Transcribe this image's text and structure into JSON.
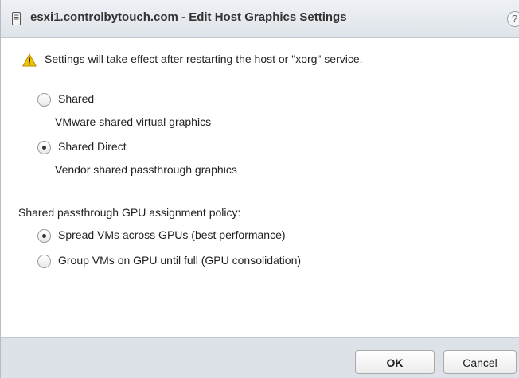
{
  "dialog": {
    "title": "esxi1.controlbytouch.com - Edit Host Graphics Settings",
    "help_icon": "question-mark-icon",
    "help_glyph": "?"
  },
  "warning": {
    "icon": "warning-triangle-icon",
    "text": "Settings will take effect after restarting the host or \"xorg\" service."
  },
  "graphics_type": {
    "selected": "Shared Direct",
    "options": [
      {
        "label": "Shared",
        "description": "VMware shared virtual graphics",
        "checked": false
      },
      {
        "label": "Shared Direct",
        "description": "Vendor shared passthrough graphics",
        "checked": true
      }
    ]
  },
  "gpu_policy": {
    "label": "Shared passthrough GPU assignment policy:",
    "selected": "Spread VMs across GPUs (best performance)",
    "options": [
      {
        "label": "Spread VMs across GPUs (best performance)",
        "checked": true
      },
      {
        "label": "Group VMs on GPU until full (GPU consolidation)",
        "checked": false
      }
    ]
  },
  "buttons": {
    "ok_label": "OK",
    "cancel_label": "Cancel"
  },
  "colors": {
    "titlebar": "#dfe4ea",
    "footer": "#dce2e8",
    "warning": "#f2c200"
  }
}
